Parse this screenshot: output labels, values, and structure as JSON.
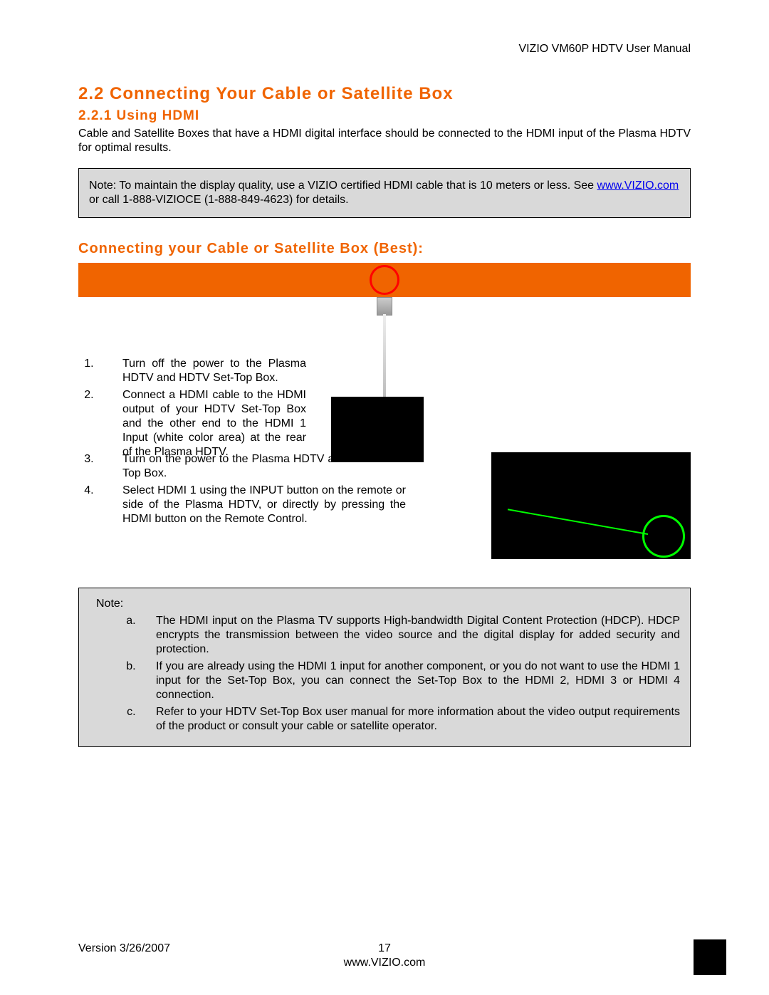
{
  "header": {
    "title": "VIZIO VM60P HDTV User Manual"
  },
  "section": {
    "h2": "2.2 Connecting Your Cable or Satellite Box",
    "h3": "2.2.1 Using HDMI",
    "intro": "Cable and Satellite Boxes that have a HDMI digital interface should be connected to the HDMI input of the Plasma HDTV for optimal results."
  },
  "note1": {
    "prefix": "Note: To maintain the display quality, use a VIZIO certified HDMI cable that is 10 meters or less.  See ",
    "link": "www.VIZIO.com",
    "suffix": " or call 1-888-VIZIOCE (1-888-849-4623) for details."
  },
  "subhead": "Connecting your Cable or Satellite Box (Best):",
  "steps": {
    "s1": "Turn off the power to the Plasma HDTV and HDTV Set-Top Box.",
    "s2": "Connect a HDMI cable to the HDMI output of your HDTV Set-Top Box and the other end to the HDMI 1 Input (white color area) at the rear of the Plasma HDTV.",
    "s3": "Turn on the power to the Plasma HDTV and HDTV Set-Top Box.",
    "s4": "Select HDMI 1 using the INPUT button on the remote or side of the Plasma HDTV, or directly by pressing the HDMI button on the Remote Control."
  },
  "note2": {
    "label": "Note:",
    "a": "The HDMI input on the Plasma TV supports High-bandwidth Digital Content Protection (HDCP).  HDCP encrypts the transmission between the video source and the digital display for added security and protection.",
    "b": "If you are already using the HDMI 1 input for another component, or you do not want to use the HDMI 1 input for the Set-Top Box, you can connect the Set-Top Box to the HDMI 2, HDMI 3 or HDMI 4 connection.",
    "c": "Refer to your HDTV Set-Top Box user manual for more information about the video output requirements of the product or consult your cable or satellite operator."
  },
  "footer": {
    "version": "Version 3/26/2007",
    "page": "17",
    "url": "www.VIZIO.com"
  }
}
